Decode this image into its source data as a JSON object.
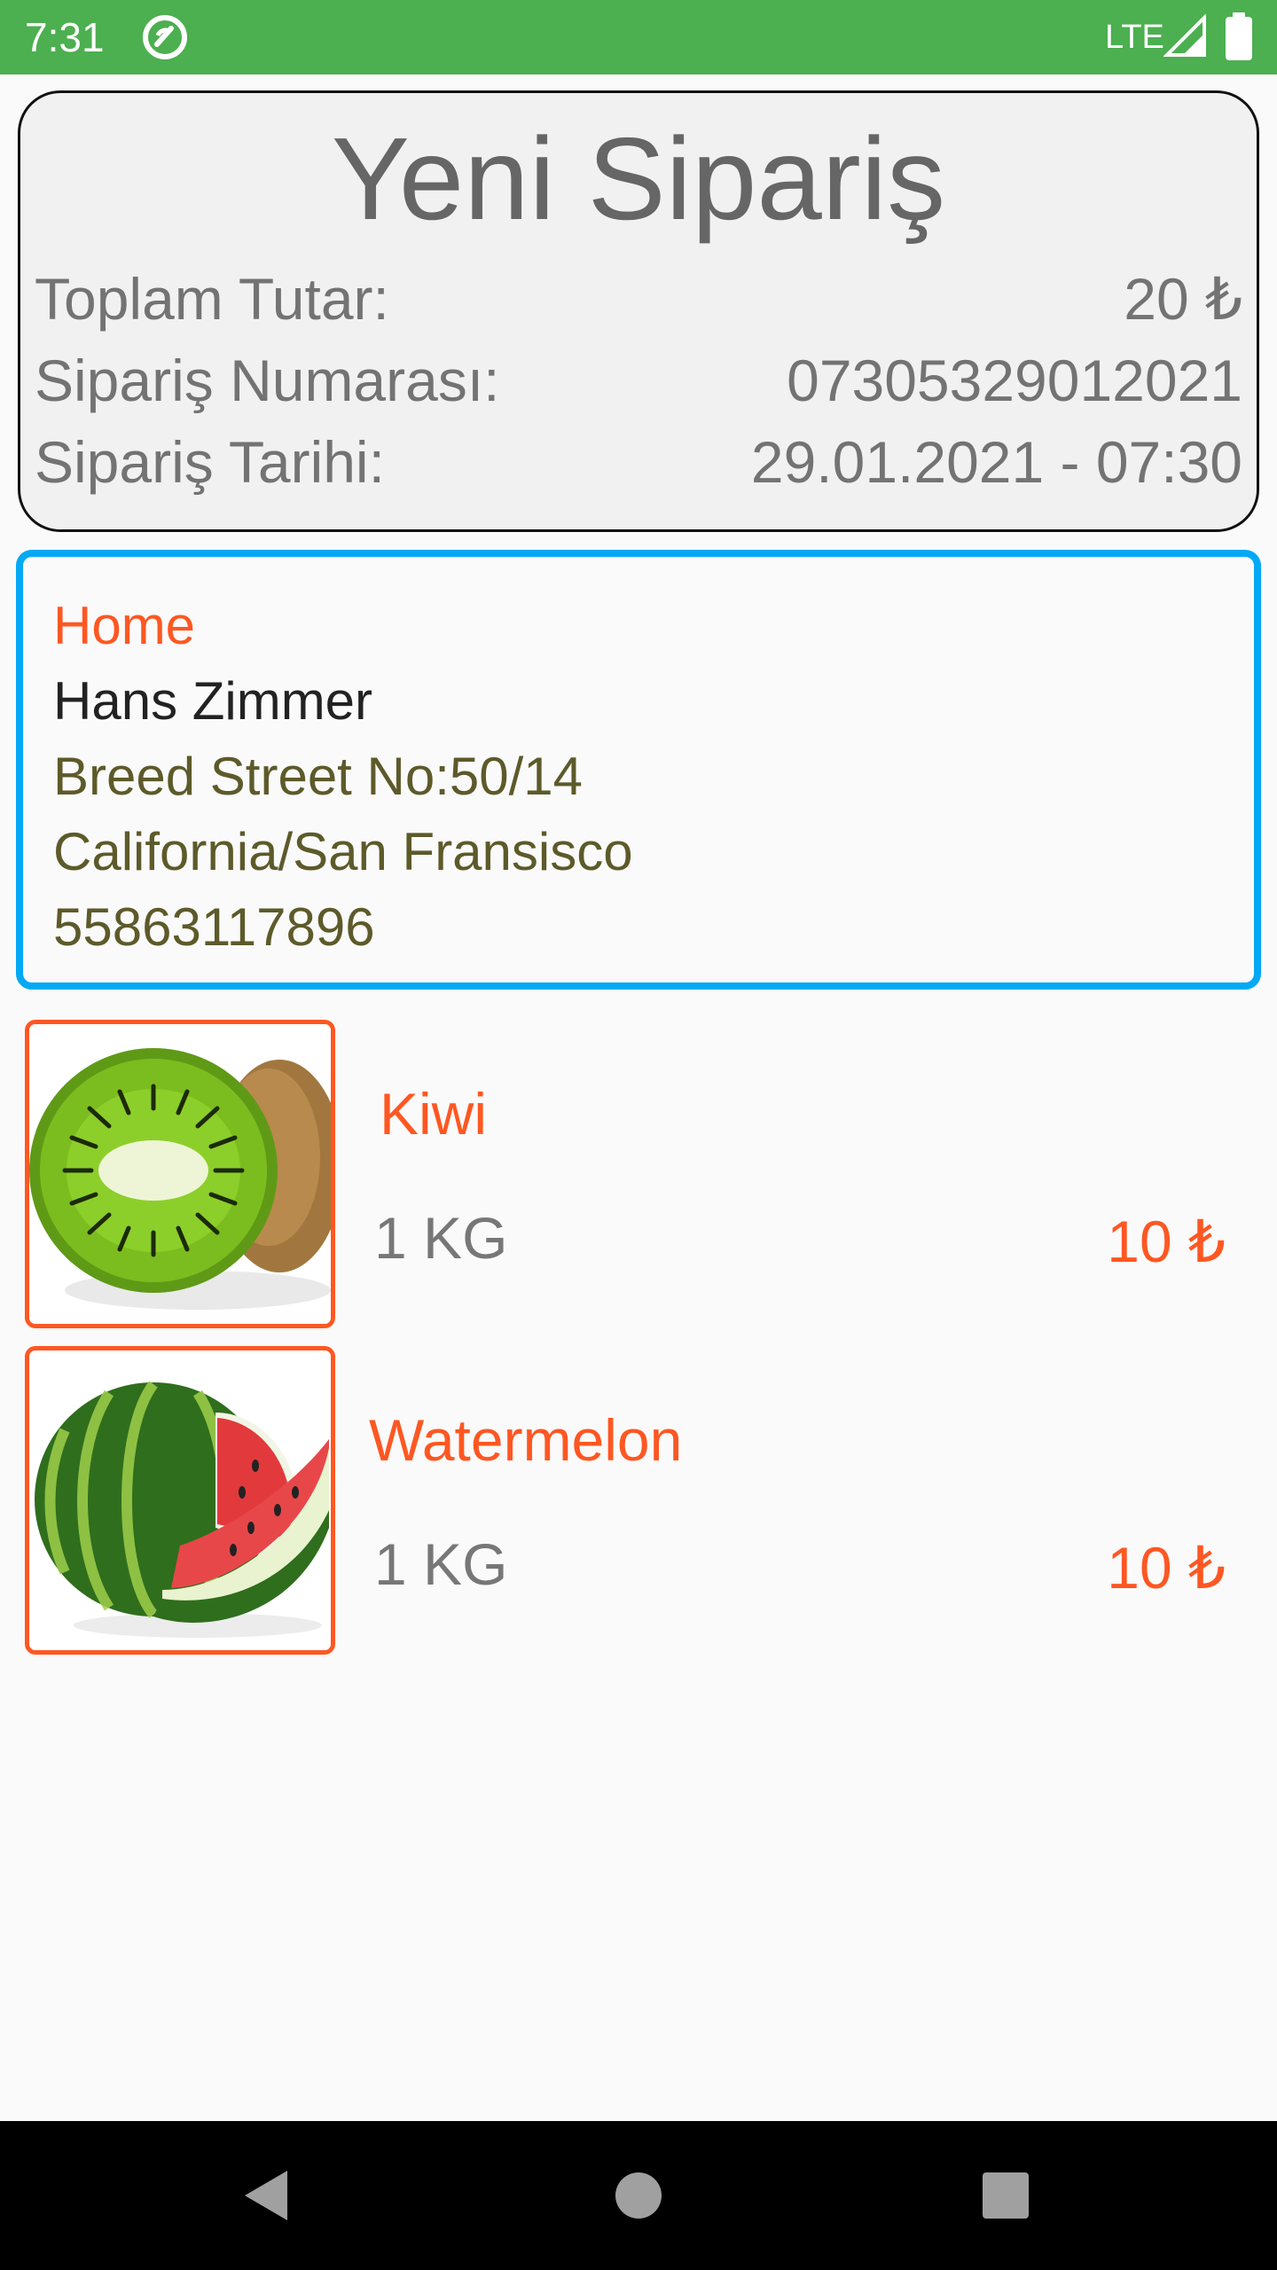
{
  "status_bar": {
    "time": "7:31",
    "network": "LTE",
    "background_color": "#4caf50"
  },
  "order_summary": {
    "title": "Yeni Sipariş",
    "rows": [
      {
        "label": "Toplam Tutar:",
        "value": "20 ₺"
      },
      {
        "label": "Sipariş Numarası:",
        "value": "07305329012021"
      },
      {
        "label": "Sipariş Tarihi:",
        "value": "29.01.2021 - 07:30"
      }
    ]
  },
  "address": {
    "title": "Home",
    "name": "Hans Zimmer",
    "street": "Breed Street No:50/14",
    "city": "California/San Fransisco",
    "phone": "55863117896",
    "border_color": "#03a9f4"
  },
  "products": [
    {
      "name": "Kiwi",
      "quantity": "1 KG",
      "price": "10 ₺",
      "image_icon": "kiwi-image"
    },
    {
      "name": "Watermelon",
      "quantity": "1 KG",
      "price": "10 ₺",
      "image_icon": "watermelon-image"
    }
  ],
  "colors": {
    "accent": "#ff5722",
    "address_text": "#5d5a2a"
  },
  "nav_bar": {
    "icons": [
      "back-icon",
      "home-icon",
      "recents-icon"
    ]
  }
}
